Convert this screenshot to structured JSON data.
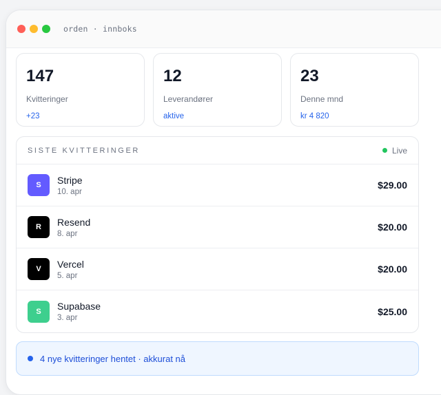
{
  "window": {
    "title": "orden · innboks"
  },
  "stats": [
    {
      "value": "147",
      "label": "Kvitteringer",
      "sub": "+23"
    },
    {
      "value": "12",
      "label": "Leverandører",
      "sub": "aktive"
    },
    {
      "value": "23",
      "label": "Denne mnd",
      "sub": "kr 4 820"
    }
  ],
  "receipts": {
    "title": "SISTE KVITTERINGER",
    "live_label": "Live",
    "items": [
      {
        "initial": "S",
        "name": "Stripe",
        "date": "10. apr",
        "amount": "$29.00",
        "color": "#635bff"
      },
      {
        "initial": "R",
        "name": "Resend",
        "date": "8. apr",
        "amount": "$20.00",
        "color": "#000000"
      },
      {
        "initial": "V",
        "name": "Vercel",
        "date": "5. apr",
        "amount": "$20.00",
        "color": "#000000"
      },
      {
        "initial": "S",
        "name": "Supabase",
        "date": "3. apr",
        "amount": "$25.00",
        "color": "#3ecf8e"
      }
    ]
  },
  "notice": {
    "text": "4 nye kvitteringer hentet · akkurat nå"
  }
}
